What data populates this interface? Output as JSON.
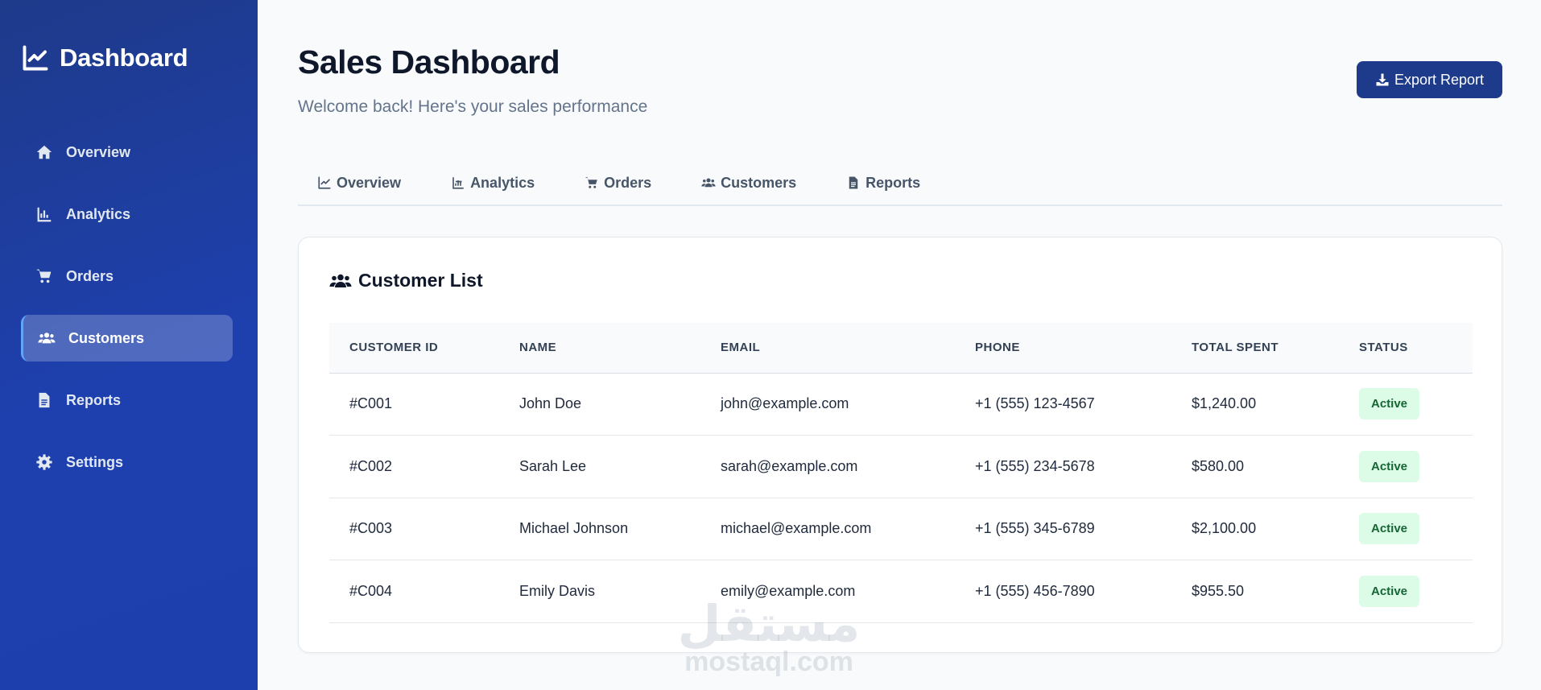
{
  "sidebar": {
    "brand": "Dashboard",
    "items": [
      {
        "label": "Overview",
        "icon": "home-icon"
      },
      {
        "label": "Analytics",
        "icon": "chart-bar-icon"
      },
      {
        "label": "Orders",
        "icon": "cart-icon"
      },
      {
        "label": "Customers",
        "icon": "users-icon",
        "active": true
      },
      {
        "label": "Reports",
        "icon": "file-icon"
      },
      {
        "label": "Settings",
        "icon": "gear-icon"
      }
    ]
  },
  "header": {
    "title": "Sales Dashboard",
    "subtitle": "Welcome back! Here's your sales performance",
    "export_label": "Export Report"
  },
  "tabs": [
    {
      "label": "Overview",
      "icon": "line-chart-icon"
    },
    {
      "label": "Analytics",
      "icon": "chart-bar-icon"
    },
    {
      "label": "Orders",
      "icon": "cart-icon"
    },
    {
      "label": "Customers",
      "icon": "users-icon"
    },
    {
      "label": "Reports",
      "icon": "file-icon"
    }
  ],
  "customers": {
    "title": "Customer List",
    "columns": [
      "CUSTOMER ID",
      "NAME",
      "EMAIL",
      "PHONE",
      "TOTAL SPENT",
      "STATUS"
    ],
    "rows": [
      {
        "id": "#C001",
        "name": "John Doe",
        "email": "john@example.com",
        "phone": "+1 (555) 123-4567",
        "spent": "$1,240.00",
        "status": "Active"
      },
      {
        "id": "#C002",
        "name": "Sarah Lee",
        "email": "sarah@example.com",
        "phone": "+1 (555) 234-5678",
        "spent": "$580.00",
        "status": "Active"
      },
      {
        "id": "#C003",
        "name": "Michael Johnson",
        "email": "michael@example.com",
        "phone": "+1 (555) 345-6789",
        "spent": "$2,100.00",
        "status": "Active"
      },
      {
        "id": "#C004",
        "name": "Emily Davis",
        "email": "emily@example.com",
        "phone": "+1 (555) 456-7890",
        "spent": "$955.50",
        "status": "Active"
      }
    ]
  },
  "watermark": {
    "arabic": "مستقل",
    "latin": "mostaql.com"
  },
  "colors": {
    "sidebar": "#1e40af",
    "primary_button": "#1e3a8a",
    "badge_bg": "#dcfce7",
    "badge_text": "#166534"
  }
}
